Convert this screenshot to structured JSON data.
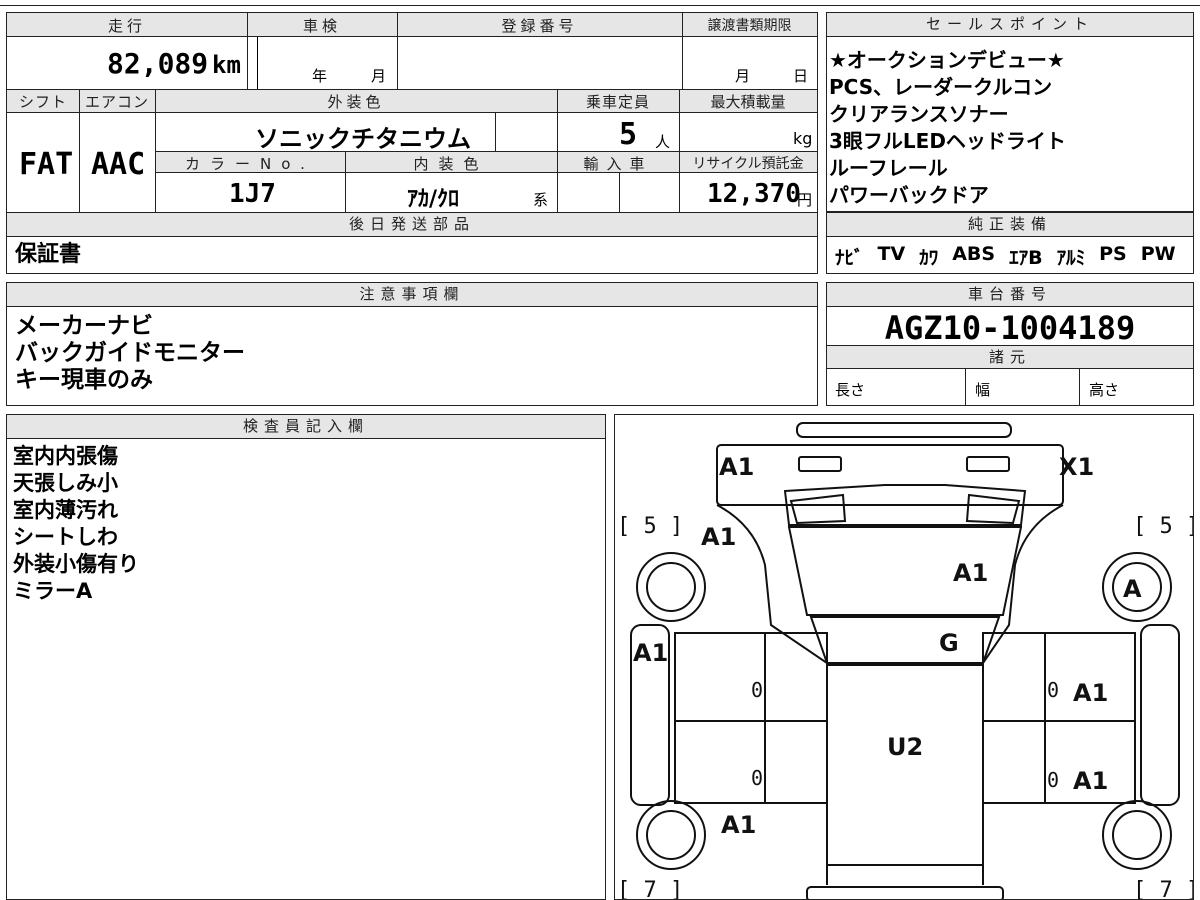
{
  "top": {
    "mileage_label": "走行",
    "mileage_value": "82,089",
    "mileage_unit": "km",
    "shaken_label": "車検",
    "shaken_year": "年",
    "shaken_month": "月",
    "reg_label": "登録番号",
    "doc_label": "譲渡書類期限",
    "doc_month": "月",
    "doc_day": "日",
    "shift_label": "シフト",
    "shift_value": "FAT",
    "ac_label": "エアコン",
    "ac_value": "AAC",
    "ext_color_label": "外装色",
    "ext_color_value": "ソニックチタニウム",
    "capacity_label": "乗車定員",
    "capacity_value": "5",
    "capacity_unit": "人",
    "max_load_label": "最大積載量",
    "max_load_unit": "kg",
    "color_no_label": "カラーNo.",
    "color_no_value": "1J7",
    "int_color_label": "内装色",
    "int_color_value": "ｱｶ/ｸﾛ",
    "int_color_suffix": "系",
    "import_label": "輸入車",
    "recycle_label": "リサイクル預託金",
    "recycle_value": "12,370",
    "recycle_unit": "円",
    "later_parts_label": "後日発送部品",
    "later_parts_value": "保証書"
  },
  "sales": {
    "label": "セールスポイント",
    "lines": [
      "★オークションデビュー★",
      "PCS、レーダークルコン",
      "クリアランスソナー",
      "3眼フルLEDヘッドライト",
      "ルーフレール",
      "パワーバックドア"
    ]
  },
  "equipment": {
    "label": "純正装備",
    "items": [
      "ﾅﾋﾞ",
      "TV",
      "ｶﾜ",
      "ABS",
      "ｴｱB",
      "ｱﾙﾐ",
      "PS",
      "PW"
    ]
  },
  "notes": {
    "label": "注意事項欄",
    "lines": [
      "メーカーナビ",
      "バックガイドモニター",
      "キー現車のみ"
    ]
  },
  "chassis": {
    "label": "車台番号",
    "value": "AGZ10-1004189",
    "spec_label": "諸元",
    "length_label": "長さ",
    "width_label": "幅",
    "height_label": "高さ"
  },
  "inspector": {
    "label": "検査員記入欄",
    "lines": [
      "室内内張傷",
      "天張しみ小",
      "室内薄汚れ",
      "シートしわ",
      "外装小傷有り",
      "ミラーA"
    ]
  },
  "diagram": {
    "front_left": "A1",
    "front_right": "X1",
    "tread_fl": "[ 5 ]",
    "tread_fr": "[ 5 ]",
    "tread_rl": "[ 7 ]",
    "tread_rr": "[ 7 ]",
    "fender_left": "A1",
    "hood": "A1",
    "wheel_right_front": "A",
    "windshield": "G",
    "left_side": "A1",
    "right_front_door": "A1",
    "right_rear_door": "A1",
    "roof": "U2",
    "left_rear": "A1",
    "door_fl": "0",
    "door_rl": "0",
    "door_fr": "0",
    "door_rr": "0"
  }
}
